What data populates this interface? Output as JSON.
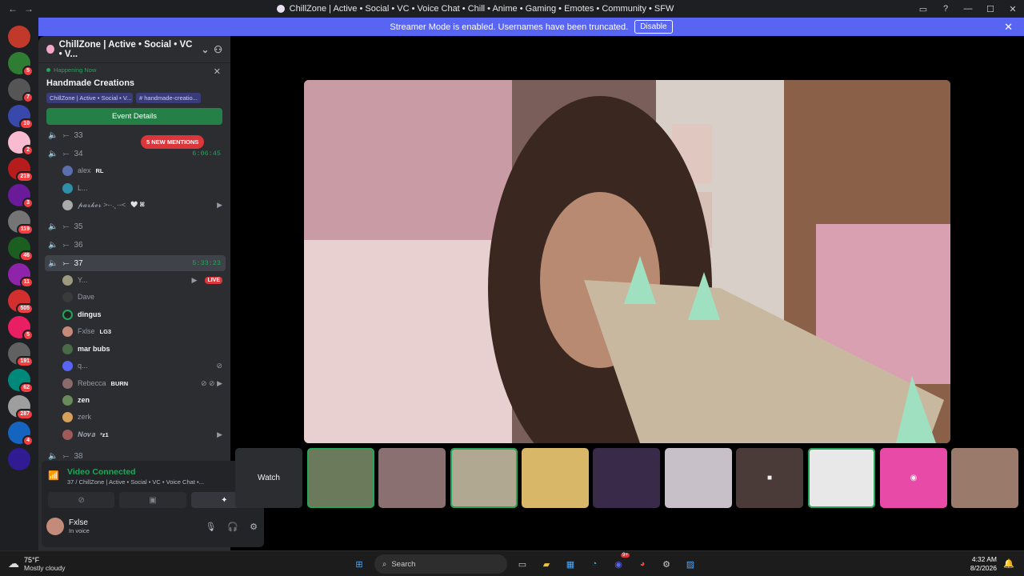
{
  "titlebar": {
    "title": "ChillZone | Active • Social • VC • Voice Chat • Chill • Anime • Gaming • Emotes • Community • SFW"
  },
  "banner": {
    "text": "Streamer Mode is enabled. Usernames have been truncated.",
    "button": "Disable"
  },
  "servers": {
    "badges": [
      "5",
      "7",
      "10",
      "2",
      "219",
      "3",
      "119",
      "46",
      "11",
      "505",
      "5",
      "191",
      "62",
      "287",
      "4"
    ]
  },
  "sidebar": {
    "server_name": "ChillZone | Active • Social • VC • V...",
    "event": {
      "status": "Happening Now",
      "title": "Handmade Creations",
      "location": "ChillZone | Active • Social • V...",
      "channel": "# handmade-creatio...",
      "button": "Event Details"
    },
    "mentions": "5 NEW MENTIONS",
    "channels": [
      {
        "name": "33",
        "timer": ""
      },
      {
        "name": "34",
        "timer": "6:06:45"
      },
      {
        "name": "35",
        "timer": ""
      },
      {
        "name": "36",
        "timer": ""
      },
      {
        "name": "37",
        "timer": "5:33:23"
      },
      {
        "name": "38",
        "timer": ""
      }
    ],
    "users34": [
      {
        "name": "alex",
        "tag": "RL"
      },
      {
        "name": "L...",
        "tag": ""
      },
      {
        "name": "𝓹𝓪𝓻𝓴𝓮𝓻 >-·.˛·-<",
        "tag": "🤍 ꕤ"
      }
    ],
    "users37": [
      {
        "name": "Y...",
        "tag": "",
        "live": "LIVE"
      },
      {
        "name": "Dave",
        "tag": ""
      },
      {
        "name": "dingus",
        "tag": ""
      },
      {
        "name": "Fxlse",
        "tag": "LG3"
      },
      {
        "name": "mar bubs",
        "tag": ""
      },
      {
        "name": "q...",
        "tag": ""
      },
      {
        "name": "Rebecca",
        "tag": "BURN"
      },
      {
        "name": "zen",
        "tag": ""
      },
      {
        "name": "zerk",
        "tag": ""
      },
      {
        "name": "𝑵𝒐𝒗𝒂",
        "tag": "²z1"
      }
    ]
  },
  "voice_panel": {
    "status": "Video Connected",
    "channel": "37 / ChillZone | Active • Social • VC • Voice Chat •...",
    "user": "Fxlse",
    "user_status": "In voice"
  },
  "tiles": {
    "watch": "Watch"
  },
  "taskbar": {
    "temp": "75°F",
    "weather": "Mostly cloudy",
    "search": "Search",
    "time": "4:32 AM",
    "date": "8/2/2026",
    "discord_badge": "9+"
  },
  "colors": {
    "accent": "#5865f2",
    "green": "#23a55a",
    "red": "#da373c",
    "sidebar": "#2b2d31"
  }
}
